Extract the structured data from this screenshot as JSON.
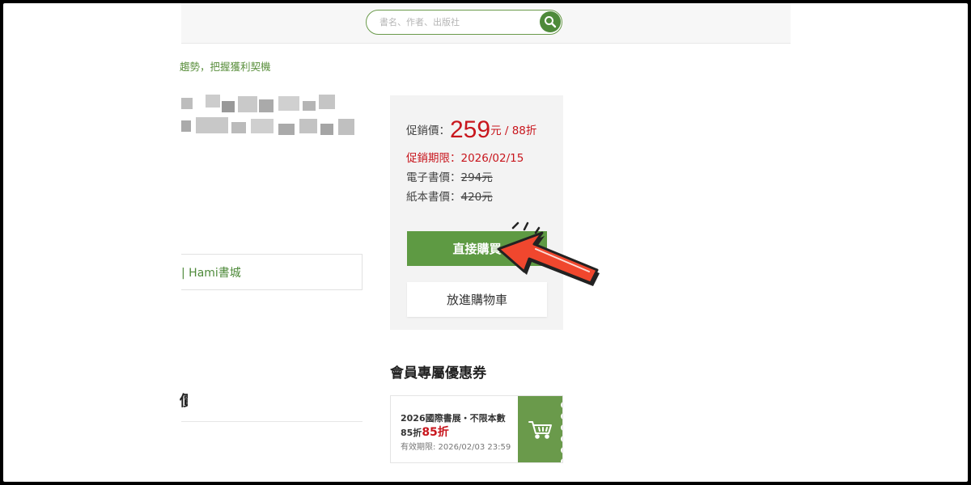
{
  "search": {
    "placeholder": "書名、作者、出版社"
  },
  "breadcrumb": {
    "text": "趨勢，把握獲利契機"
  },
  "left": {
    "hami_link": "| Hami書城",
    "cut_heading": "價"
  },
  "price": {
    "promo_label": "促銷價：",
    "promo_price": "259",
    "promo_suffix": "元 / 88折",
    "promo_period_label": "促銷期限：",
    "promo_period": "2026/02/15",
    "ebook_label": "電子書價：",
    "ebook_price": "294元",
    "paper_label": "紙本書價：",
    "paper_price": "420元"
  },
  "actions": {
    "buy": "直接購買",
    "cart": "放進購物車"
  },
  "coupons": {
    "title": "會員專屬優惠券",
    "items": [
      {
        "name": "2026國際書展・不限本數",
        "discount_prefix": "85折",
        "discount": "85折",
        "expiry": "有效期限: 2026/02/03 23:59"
      }
    ]
  },
  "colors": {
    "accent": "#5e9a43",
    "price_red": "#c8161d",
    "link_green": "#4e8a3a"
  },
  "icons": {
    "search": "search-icon",
    "cart": "cart-icon",
    "arrow": "pointer-arrow-icon"
  }
}
